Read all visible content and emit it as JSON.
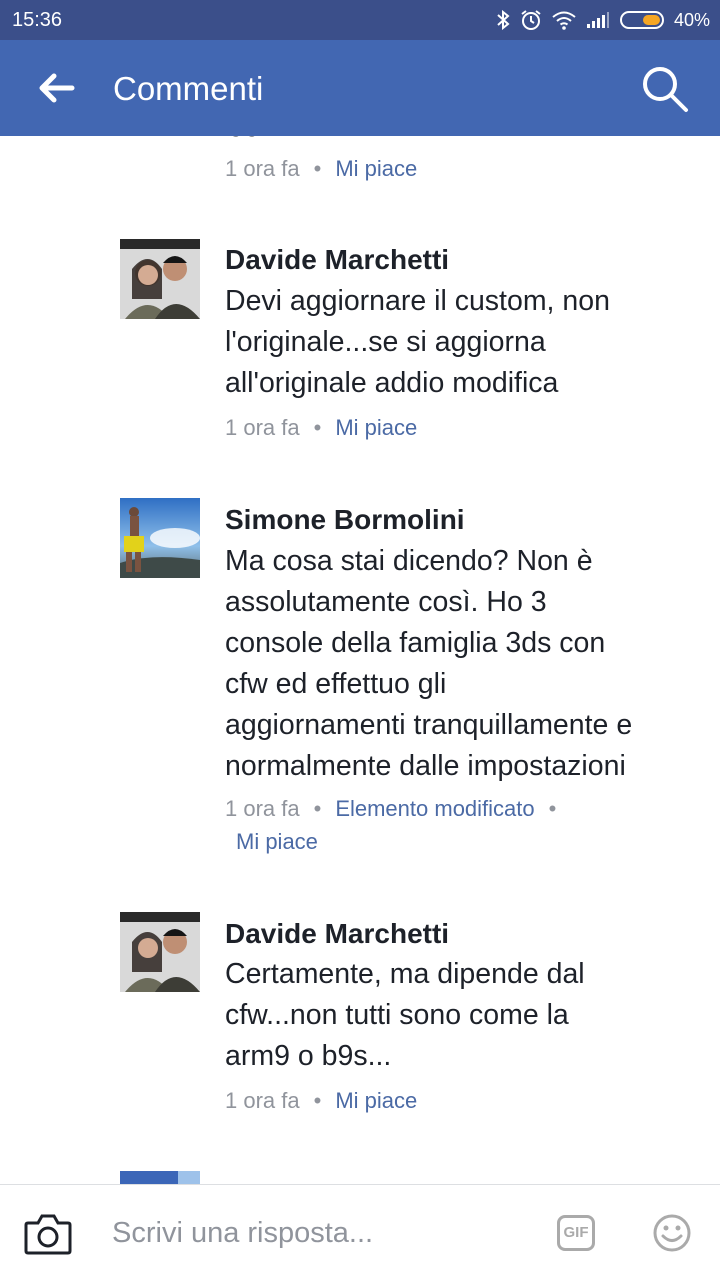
{
  "status": {
    "time": "15:36",
    "battery": "40%",
    "icons": [
      "bluetooth-icon",
      "alarm-icon",
      "wifi-icon",
      "signal-icon",
      "battery-icon"
    ]
  },
  "header": {
    "title": "Commenti",
    "back_icon": "arrow-left-icon",
    "search_icon": "search-icon"
  },
  "colors": {
    "statusbar": "#3b4f8a",
    "appbar": "#4267b2",
    "link": "#4b6aa5",
    "meta": "#90949c"
  },
  "top_partial": {
    "time": "1 ora fa",
    "like": "Mi piace"
  },
  "comments": [
    {
      "name": "Davide Marchetti",
      "lines": [
        "Devi aggiornare il custom, non",
        "l'originale...se si aggiorna",
        "all'originale addio modifica"
      ],
      "time": "1 ora fa",
      "like": "Mi piace"
    },
    {
      "name": "Simone Bormolini",
      "lines": [
        "Ma cosa stai dicendo? Non è",
        "assolutamente così. Ho 3",
        "console della famiglia 3ds con",
        "cfw  ed effettuo gli",
        "aggiornamenti tranquillamente e",
        "normalmente dalle impostazioni"
      ],
      "time": "1 ora fa",
      "edited": "Elemento modificato",
      "like": "Mi piace"
    },
    {
      "name": "Davide Marchetti",
      "lines": [
        "Certamente, ma dipende dal",
        "cfw...non tutti sono come la",
        "arm9 o b9s..."
      ],
      "time": "1 ora fa",
      "like": "Mi piace"
    }
  ],
  "composer": {
    "placeholder": "Scrivi una risposta...",
    "gif_label": "GIF",
    "camera_icon": "camera-icon",
    "emoji_icon": "smiley-icon"
  }
}
